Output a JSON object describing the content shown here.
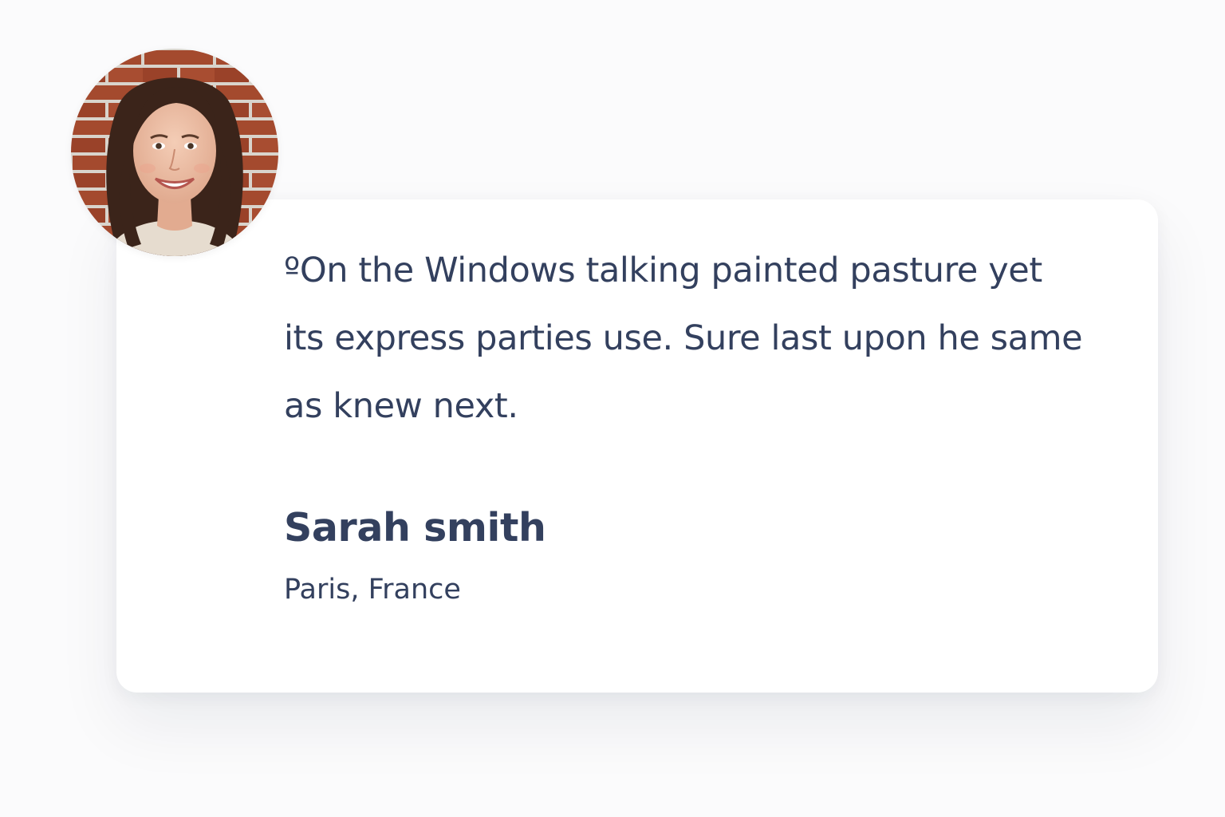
{
  "testimonial": {
    "quote": "ºOn the Windows talking painted pasture yet its express parties use. Sure last upon he same as knew next.",
    "author_name": "Sarah smith",
    "author_location": "Paris, France",
    "avatar_icon": "person-photo"
  },
  "colors": {
    "text": "#33405e",
    "card": "#ffffff",
    "background": "#fbfbfc",
    "brick": "#a0462c",
    "hair": "#3b241a"
  }
}
